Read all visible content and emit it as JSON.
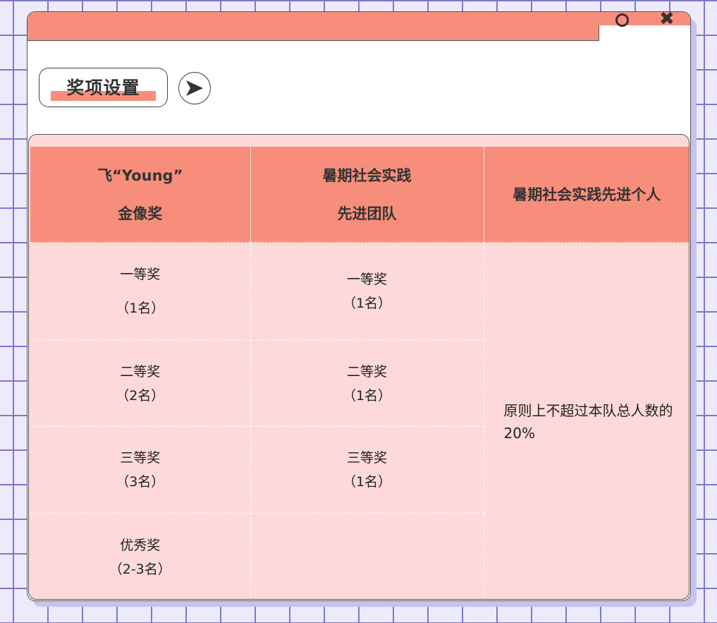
{
  "window": {
    "title_controls": [
      "circle",
      "close"
    ]
  },
  "section": {
    "title": "奖项设置",
    "arrow_icon": "right-arrow-icon"
  },
  "colors": {
    "accent": "#f78e7c",
    "table_bg": "#fdd9d9",
    "grid_line": "#7f78c9",
    "page_bg": "#ecebfb"
  },
  "table": {
    "headers": [
      {
        "line1": "飞“Young”",
        "line2": "金像奖"
      },
      {
        "line1": "暑期社会实践",
        "line2": "先进团队"
      },
      {
        "line1": "暑期社会实践先进个人",
        "line2": ""
      }
    ],
    "col1": [
      {
        "name": "一等奖",
        "count": "（1名）"
      },
      {
        "name": "二等奖",
        "count": "（2名）"
      },
      {
        "name": "三等奖",
        "count": "（3名）"
      },
      {
        "name": "优秀奖",
        "count": "（2-3名）"
      }
    ],
    "col2": [
      {
        "name": "一等奖",
        "count": "（1名）"
      },
      {
        "name": "二等奖",
        "count": "（1名）"
      },
      {
        "name": "三等奖",
        "count": "（1名）"
      }
    ],
    "col3_note": "原则上不超过本队总人数的20%"
  }
}
